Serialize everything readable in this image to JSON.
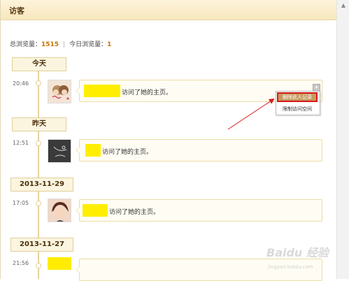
{
  "header": {
    "title": "访客"
  },
  "stats": {
    "total_label": "总浏览量：",
    "total_value": "1515",
    "separator": "|",
    "today_label": "今日浏览量：",
    "today_value": "1"
  },
  "groups": [
    {
      "date": "今天",
      "entries": [
        {
          "time": "20:46",
          "action": "访问了她的主页。"
        }
      ]
    },
    {
      "date": "昨天",
      "entries": [
        {
          "time": "12:51",
          "action": "访问了她的主页。"
        }
      ]
    },
    {
      "date": "2013-11-29",
      "entries": [
        {
          "time": "17:05",
          "action": "访问了她的主页。"
        }
      ]
    },
    {
      "date": "2013-11-27",
      "entries": [
        {
          "time": "21:56",
          "action": ""
        }
      ]
    }
  ],
  "context_menu": {
    "toggle_symbol": "▾",
    "delete_label": "删除此人记录",
    "restrict_label": "限制访问空间"
  },
  "watermark": {
    "text": "Baidu 经验",
    "subtext": "jingyan.baidu.com"
  },
  "colors": {
    "accent_orange": "#c47200",
    "highlight_yellow": "#ffee00",
    "annotation_red": "#d61b1b",
    "bubble_border": "#ecdca5"
  },
  "icons": [
    "chevron-down-icon",
    "scroll-up-icon"
  ]
}
